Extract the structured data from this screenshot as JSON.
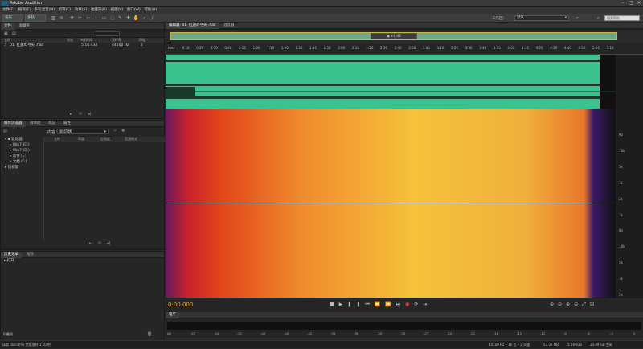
{
  "window": {
    "title": "Adobe Audition",
    "controls": [
      "–",
      "□",
      "×"
    ]
  },
  "menu": [
    "文件(F)",
    "编辑(E)",
    "多轨混音(M)",
    "剪辑(C)",
    "效果(S)",
    "收藏夹(R)",
    "视图(V)",
    "窗口(W)",
    "帮助(H)"
  ],
  "toolbar": {
    "waveform_label": "波形",
    "multitrack_label": "多轨",
    "workspace_label": "工作区：",
    "workspace_value": "默认",
    "search_placeholder": "搜索帮助"
  },
  "files_panel": {
    "tabs": [
      "文件",
      "收藏夹"
    ],
    "columns": [
      "名称",
      "状态",
      "持续时间",
      "采样率",
      "声道"
    ],
    "rows": [
      {
        "name": "01. 红蓮の弓矢 .flac",
        "duration": "5:16.933",
        "rate": "44100 Hz",
        "channels": "2"
      }
    ]
  },
  "browser_panel": {
    "tabs": [
      "媒体浏览器",
      "效果组",
      "标记",
      "属性"
    ],
    "content_label": "内容：",
    "content_value": "驱动器",
    "tree": [
      "驱动器",
      "Win7 (C:)",
      "Win7 (D:)",
      "软件 (E:)",
      "文档 (F:)",
      "快捷键"
    ],
    "columns": [
      "名称",
      "声道",
      "位深度",
      "音频格式"
    ]
  },
  "history_panel": {
    "tabs": [
      "历史记录",
      "视频"
    ],
    "items": [
      "打开"
    ],
    "count_label": "0 撤消"
  },
  "editor": {
    "tab": "编辑器: 01. 红蓮の弓矢 .flac",
    "tab2": "混音器",
    "time_ruler": [
      "hms",
      "0:10",
      "0:20",
      "0:30",
      "0:40",
      "0:50",
      "1:00",
      "1:10",
      "1:20",
      "1:30",
      "1:40",
      "1:50",
      "2:00",
      "2:10",
      "2:20",
      "2:30",
      "2:40",
      "2:50",
      "3:00",
      "3:10",
      "3:20",
      "3:30",
      "3:40",
      "3:50",
      "4:00",
      "4:10",
      "4:20",
      "4:30",
      "4:40",
      "4:50",
      "5:00",
      "5:10"
    ],
    "hz_top": [
      "Hz",
      "10k",
      "5k",
      "3k",
      "2k",
      "1k"
    ],
    "hz_bottom": [
      "Hz",
      "10k",
      "5k",
      "3k",
      "2k",
      "1k"
    ],
    "db_readout": "+0 dB",
    "time_display": "0:00.000"
  },
  "levels": {
    "tab": "电平",
    "scale": [
      "dB",
      "-57",
      "-54",
      "-51",
      "-48",
      "-45",
      "-42",
      "-39",
      "-36",
      "-33",
      "-30",
      "-27",
      "-24",
      "-21",
      "-18",
      "-15",
      "-12",
      "-9",
      "-6",
      "-3",
      "0"
    ]
  },
  "status": {
    "left": "读取 libsndfile 完成用时 1.50 秒",
    "rate": "44100 Hz • 16 位 • 2 声道",
    "size": "53.32 MB",
    "duration": "5:16.933",
    "free": "23.89 GB 空闲"
  },
  "colors": {
    "waveform": "#3cc28e",
    "accent": "#f5c23a"
  }
}
